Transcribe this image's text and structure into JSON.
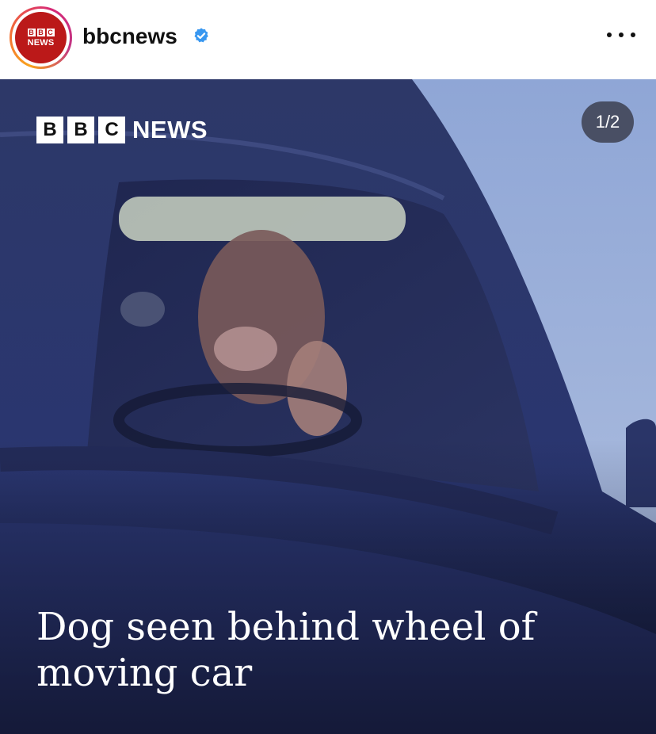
{
  "header": {
    "username": "bbcnews",
    "avatar_blocks": [
      "B",
      "B",
      "C"
    ],
    "avatar_word": "NEWS",
    "verified_icon": "verified-badge-icon",
    "more_icon": "more-options-icon"
  },
  "post": {
    "brand_blocks": [
      "B",
      "B",
      "C"
    ],
    "brand_word": "NEWS",
    "slide_counter": "1/2",
    "headline": "Dog seen behind wheel of moving car"
  },
  "colors": {
    "bbc_red": "#bb1919",
    "verified_blue": "#3897f0",
    "car_body": "#2c376a",
    "sky": "#9fb4d9"
  }
}
